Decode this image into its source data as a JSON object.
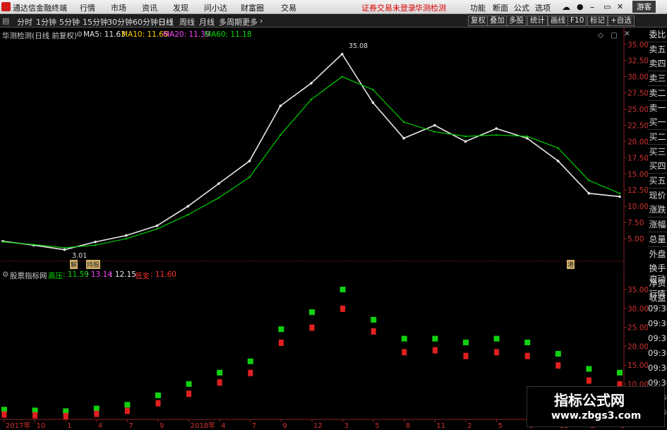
{
  "menubar": {
    "app_title": "通达信金融终端",
    "items": [
      "行情",
      "市场",
      "资讯",
      "发现",
      "问小达",
      "财富圈",
      "交易"
    ],
    "notice": "证券交易未登录",
    "stock_link": "华测检测",
    "right_items": [
      "功能",
      "断面",
      "公式",
      "选项"
    ],
    "guest": "游客"
  },
  "timeframe_bar": {
    "periods": [
      "分时",
      "1分钟",
      "5分钟",
      "15分钟",
      "30分钟",
      "60分钟",
      "日线",
      "周线",
      "月线",
      "多周期",
      "更多"
    ],
    "active": "日线",
    "tools": [
      "复权",
      "叠加",
      "多股",
      "统计",
      "画线",
      "F10",
      "标记",
      "+自选"
    ]
  },
  "main_chart": {
    "header_title": "华测检测(日线 前复权)",
    "ma": [
      {
        "label": "MA5: 11.63",
        "color": "#e8e8e8"
      },
      {
        "label": "MA10: 11.65",
        "color": "#ffd400"
      },
      {
        "label": "MA20: 11.39",
        "color": "#ff40ff"
      },
      {
        "label": "MA60: 11.18",
        "color": "#00e000"
      }
    ],
    "high_label": "35.08",
    "low_label": "3.01",
    "event_labels": [
      "解",
      "持股",
      "港"
    ]
  },
  "sub_chart": {
    "header_title": "股票指标网",
    "stats": [
      {
        "label": "高压",
        "color": "#00e000"
      },
      {
        "label": ": 11.59",
        "color": "#00e000"
      },
      {
        "label": ": 13.14",
        "color": "#ff40ff"
      },
      {
        "label": ": 12.15",
        "color": "#e8e8e8"
      },
      {
        "label": "低支",
        "color": "#ff3030"
      },
      {
        "label": ": 11.60",
        "color": "#ff3030"
      }
    ]
  },
  "x_axis": {
    "labels": [
      "2017年",
      "10",
      "1",
      "4",
      "7",
      "9",
      "2018年",
      "4",
      "7",
      "9",
      "12",
      "3",
      "5",
      "8",
      "11",
      "2",
      "5",
      "8",
      "10",
      "2",
      "5"
    ]
  },
  "right_panel": {
    "top": [
      "委比",
      "卖五",
      "卖四",
      "卖三",
      "卖二",
      "卖一",
      "买一",
      "买二",
      "买三",
      "买四",
      "买五",
      "现价",
      "涨跌",
      "涨幅",
      "总量",
      "外盘",
      "换手",
      "净资",
      "收益"
    ],
    "bottom": [
      "自动",
      "行情",
      "09:30",
      "09:30",
      "09:30",
      "09:30",
      "09:30",
      "09:30",
      "09:30",
      "09:30"
    ]
  },
  "watermark": {
    "line1": "指标公式网",
    "line2": "www.zbgs3.com"
  },
  "chart_data": [
    {
      "type": "line",
      "title": "华测检测(日线 前复权)",
      "ylim": [
        2.5,
        36.5
      ],
      "yticks": [
        5.0,
        7.5,
        10.0,
        12.5,
        15.0,
        17.5,
        20.0,
        22.5,
        25.0,
        27.5,
        30.0,
        32.5,
        35.0
      ],
      "x": [
        "2017年",
        "10",
        "1",
        "4",
        "7",
        "9",
        "2018年",
        "4",
        "7",
        "9",
        "12",
        "3",
        "5",
        "8",
        "11",
        "2",
        "5",
        "8",
        "10",
        "2",
        "5"
      ],
      "series": [
        {
          "name": "MA5",
          "values": [
            4.6,
            4.0,
            3.3,
            4.5,
            5.5,
            7.0,
            10.0,
            13.5,
            17.0,
            25.5,
            29.0,
            33.5,
            26.0,
            20.5,
            22.5,
            20.0,
            22.0,
            20.5,
            17.0,
            12.0,
            11.5
          ]
        },
        {
          "name": "MA60",
          "values": [
            4.5,
            4.1,
            3.6,
            4.0,
            5.0,
            6.5,
            8.7,
            11.3,
            14.5,
            21.0,
            26.5,
            30.0,
            28.0,
            23.0,
            21.5,
            20.8,
            21.0,
            20.8,
            19.0,
            14.0,
            12.0
          ]
        }
      ]
    },
    {
      "type": "scatter",
      "title": "股票指标网",
      "ylim": [
        1.0,
        38.0
      ],
      "yticks": [
        5.0,
        10.0,
        15.0,
        20.0,
        25.0,
        30.0,
        35.0
      ],
      "x": [
        "2017年",
        "10",
        "1",
        "4",
        "7",
        "9",
        "2018年",
        "4",
        "7",
        "9",
        "12",
        "3",
        "5",
        "8",
        "11",
        "2",
        "5",
        "8",
        "10",
        "2",
        "5"
      ],
      "series": [
        {
          "name": "高压",
          "values": [
            3.2,
            3.0,
            2.8,
            3.5,
            4.5,
            7.0,
            10.0,
            13.0,
            16.0,
            24.5,
            29.0,
            35.0,
            27.0,
            22.0,
            22.0,
            21.0,
            22.0,
            21.0,
            18.0,
            14.0,
            13.0
          ]
        },
        {
          "name": "低支",
          "values": [
            2.0,
            1.8,
            1.6,
            2.2,
            3.0,
            5.0,
            7.5,
            10.5,
            13.0,
            21.0,
            25.0,
            30.0,
            24.0,
            18.5,
            19.0,
            17.5,
            18.5,
            17.5,
            15.0,
            11.0,
            10.0
          ]
        }
      ]
    }
  ]
}
